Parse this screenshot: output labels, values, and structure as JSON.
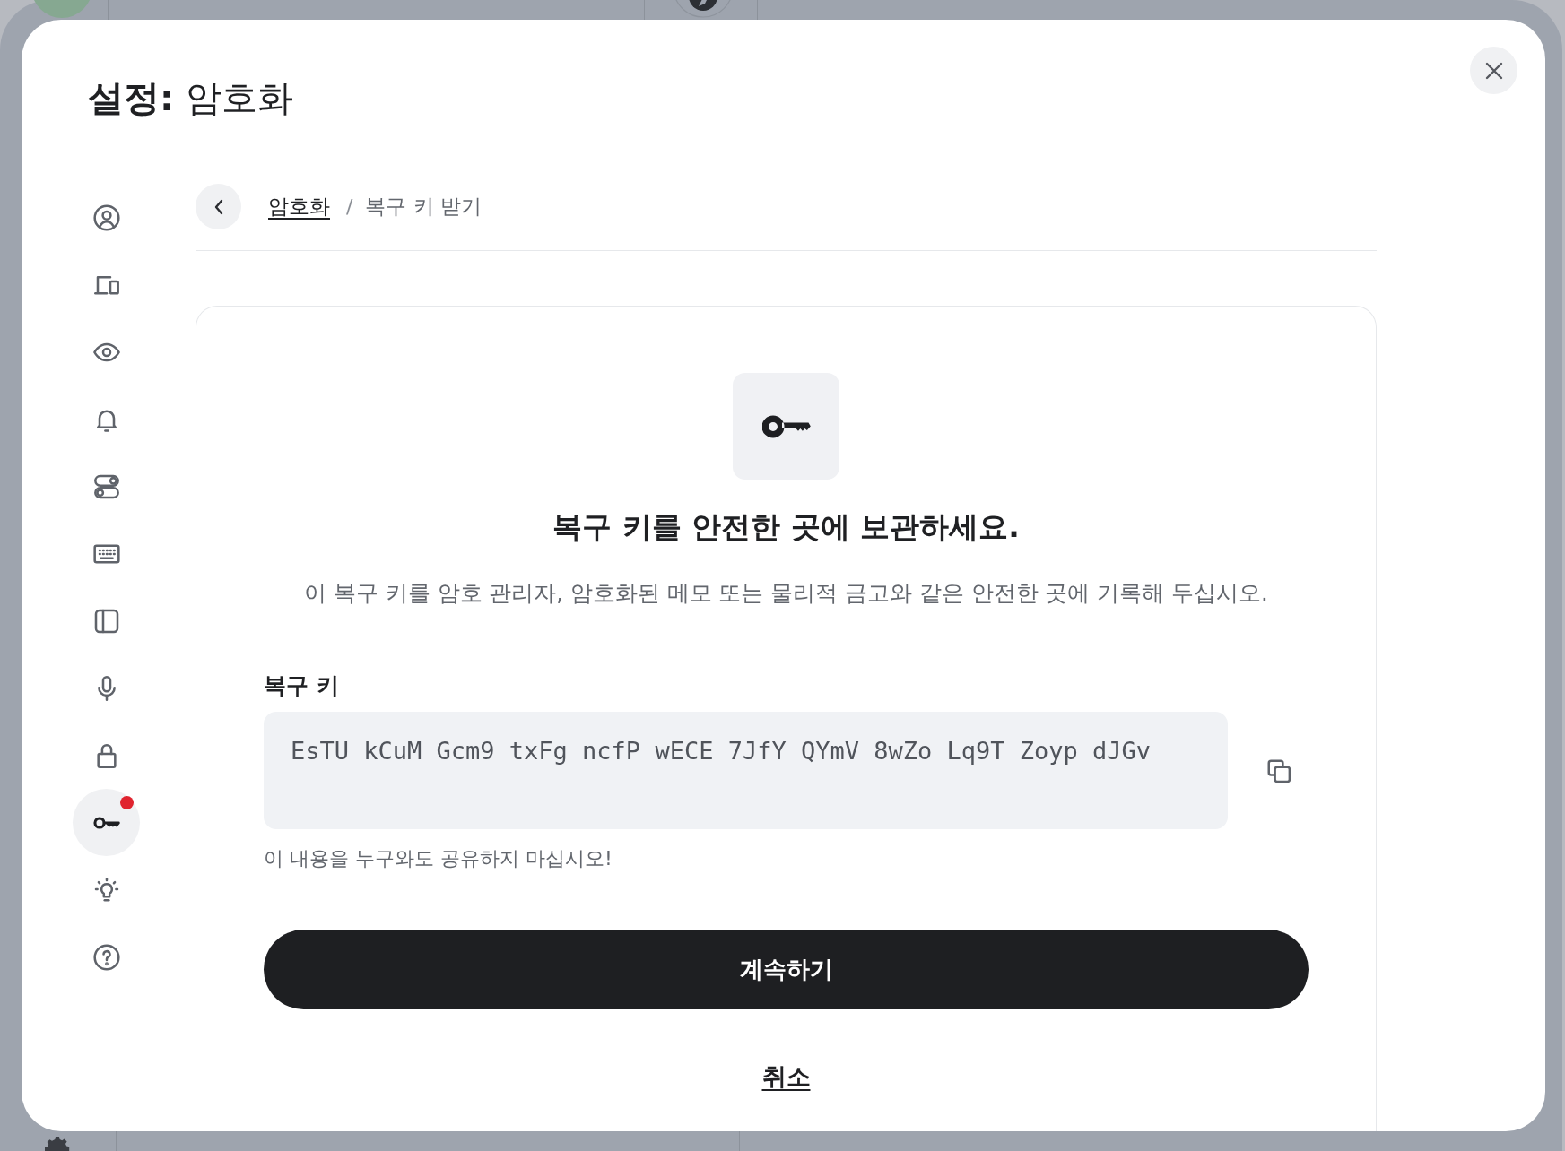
{
  "dialog": {
    "title": "**설정:** 암호화"
  },
  "sidebar": {
    "items": [
      {
        "kind": "profile",
        "selected": false,
        "notification": false
      },
      {
        "kind": "devices",
        "selected": false,
        "notification": false
      },
      {
        "kind": "visibility",
        "selected": false,
        "notification": false
      },
      {
        "kind": "notifications",
        "selected": false,
        "notification": false
      },
      {
        "kind": "toggles",
        "selected": false,
        "notification": false
      },
      {
        "kind": "keyboard",
        "selected": false,
        "notification": false
      },
      {
        "kind": "sidebar",
        "selected": false,
        "notification": false
      },
      {
        "kind": "microphone",
        "selected": false,
        "notification": false
      },
      {
        "kind": "lock",
        "selected": false,
        "notification": false
      },
      {
        "kind": "key",
        "selected": true,
        "notification": true
      },
      {
        "kind": "lightbulb",
        "selected": false,
        "notification": false
      },
      {
        "kind": "help",
        "selected": false,
        "notification": false
      }
    ]
  },
  "breadcrumb": {
    "separator": "/",
    "items": [
      {
        "kind": "link",
        "label": "암호화"
      },
      {
        "kind": "current",
        "label": "복구 키 받기"
      }
    ]
  },
  "panel": {
    "heading": "복구 키를 안전한 곳에 보관하세요.",
    "description": "이 복구 키를 암호 관리자, 암호화된 메모 또는 물리적 금고와 같은 안전한 곳에 기록해 두십시오.",
    "field": {
      "label": "복구 키",
      "value": "EsTU kCuM Gcm9 txFg ncfP wECE 7JfY QYmV 8wZo Lq9T Zoyp dJGv"
    },
    "warning": "이 내용을 누구와도 공유하지 마십시오!",
    "primary_button": "계속하기",
    "cancel_link": "취소"
  }
}
